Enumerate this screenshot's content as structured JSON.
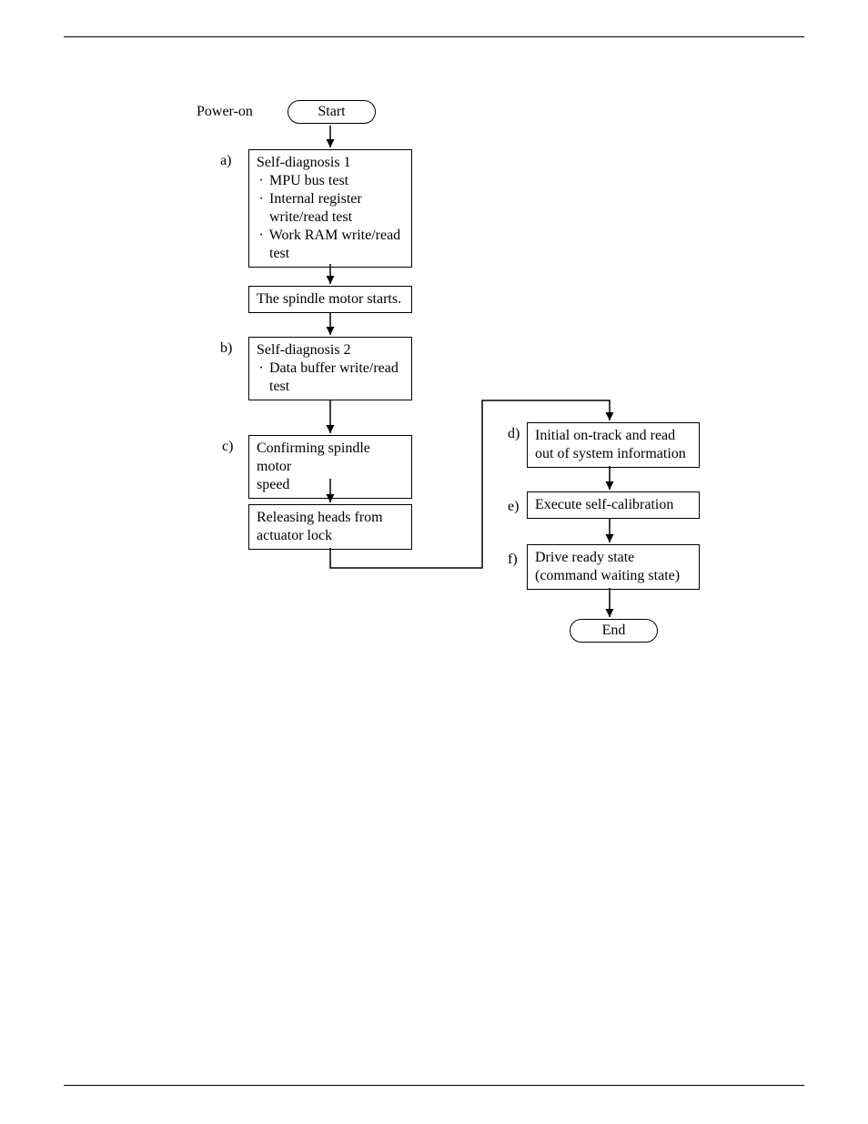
{
  "labels": {
    "power_on": "Power-on",
    "a": "a)",
    "b": "b)",
    "c": "c)",
    "d": "d)",
    "e": "e)",
    "f": "f)"
  },
  "terminators": {
    "start": "Start",
    "end": "End"
  },
  "boxes": {
    "self_diag1_title": "Self-diagnosis 1",
    "self_diag1_b1": "MPU bus test",
    "self_diag1_b2a": "Internal register",
    "self_diag1_b2b": "write/read test",
    "self_diag1_b3a": "Work RAM write/read",
    "self_diag1_b3b": "test",
    "spindle_starts": "The spindle motor starts.",
    "self_diag2_title": "Self-diagnosis 2",
    "self_diag2_b1a": "Data buffer write/read",
    "self_diag2_b1b": "test",
    "confirm_speed_a": "Confirming spindle motor",
    "confirm_speed_b": "speed",
    "release_heads_a": "Releasing heads from",
    "release_heads_b": "actuator lock",
    "initial_track_a": "Initial on-track and read",
    "initial_track_b": "out of system information",
    "exec_calib": "Execute self-calibration",
    "drive_ready_a": "Drive ready state",
    "drive_ready_b": "(command waiting state)"
  }
}
